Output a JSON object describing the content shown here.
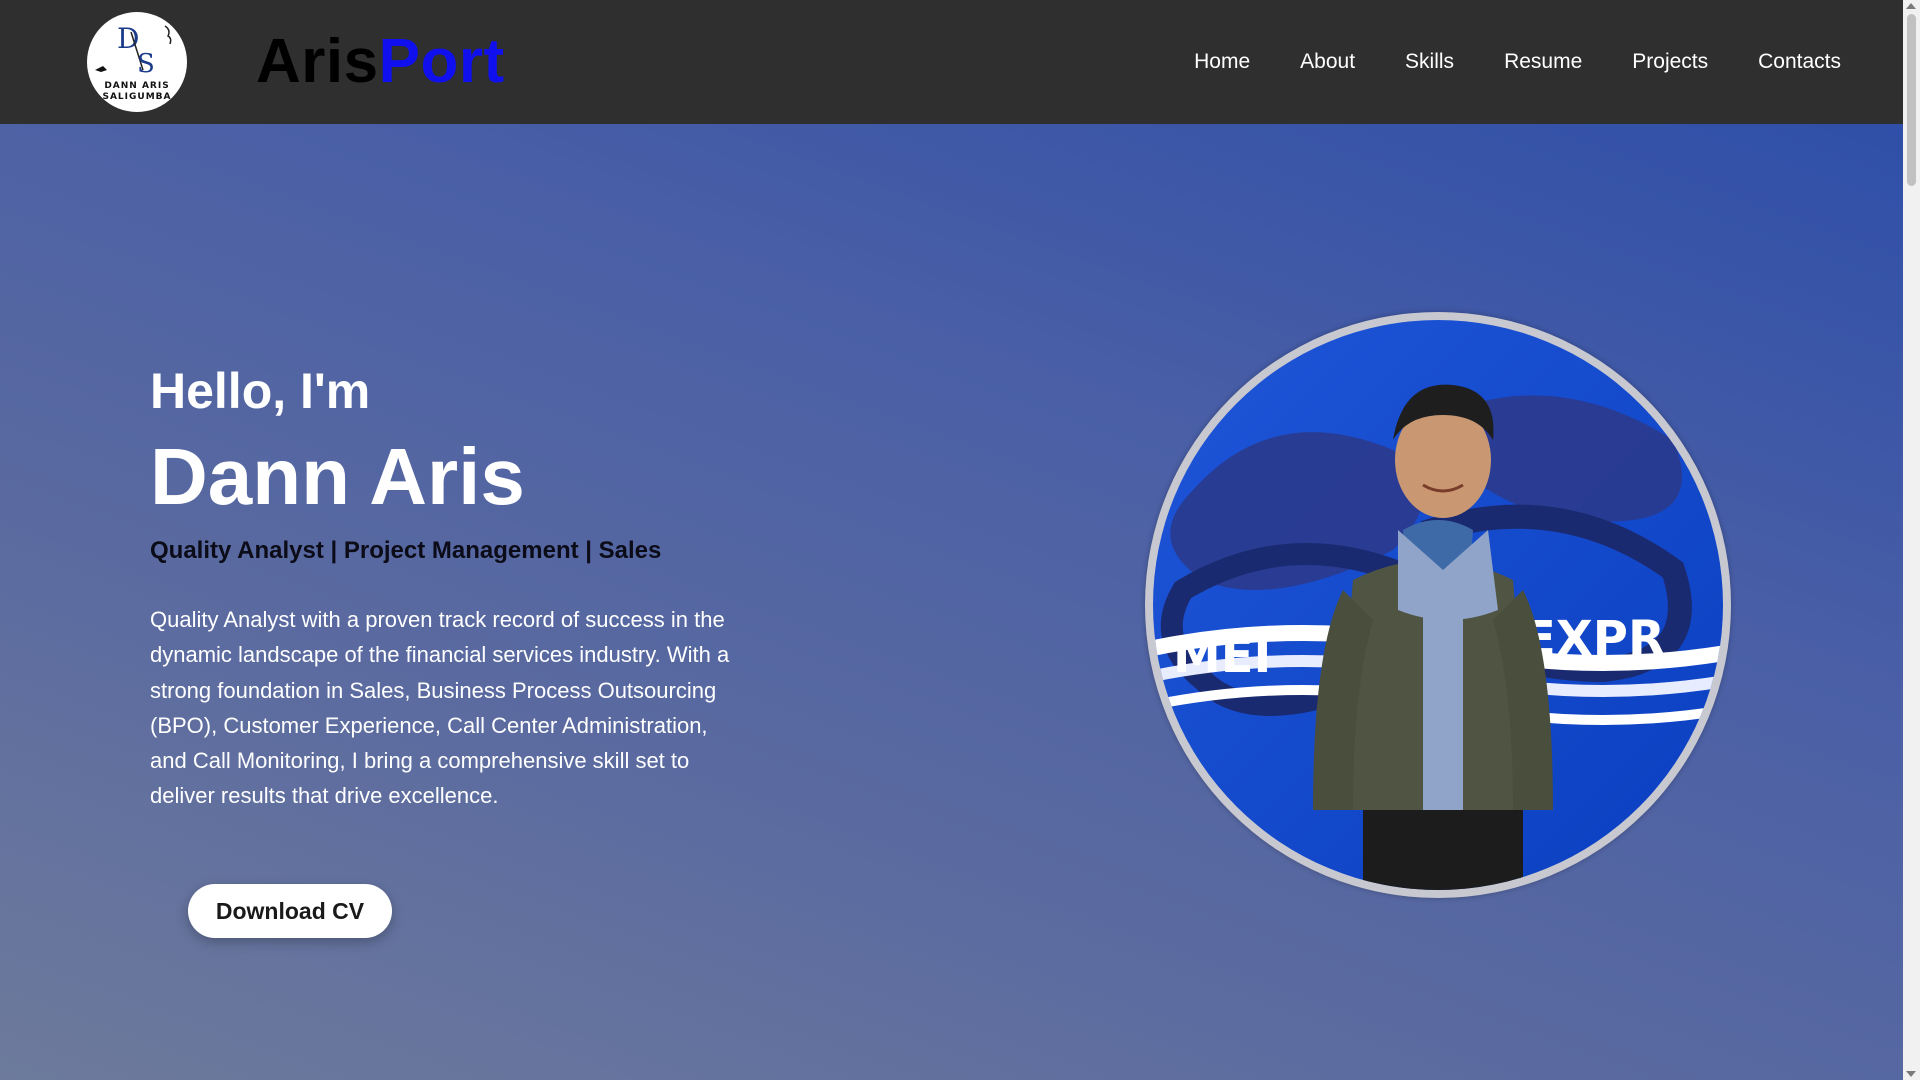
{
  "header": {
    "logo": {
      "initials": "DS",
      "caption_line1": "DANN ARIS",
      "caption_line2": "SALIGUMBA"
    },
    "brand_part1": "Aris",
    "brand_part2": "Port",
    "nav": [
      "Home",
      "About",
      "Skills",
      "Resume",
      "Projects",
      "Contacts"
    ]
  },
  "hero": {
    "greeting": "Hello, I'm",
    "name": "Dann Aris",
    "roles": "Quality Analyst | Project Management | Sales",
    "bio": "Quality Analyst with a proven track record of success in the dynamic landscape of the financial services industry. With a strong foundation in Sales, Business Process Outsourcing (BPO), Customer Experience, Call Center Administration, and Call Monitoring, I bring a comprehensive skill set to deliver results that drive excellence.",
    "cta": "Download CV",
    "photo": {
      "background_text_left": "MEI",
      "background_text_right": "EXPR"
    }
  },
  "colors": {
    "header_bg": "#2f2f2f",
    "brand_part1": "#000000",
    "brand_part2": "#1010ee",
    "hero_gradient_start": "#6d7a9c",
    "hero_gradient_end": "#2f4fa8",
    "roles_text": "#0c0c18",
    "button_bg": "#ffffff"
  },
  "icons": [
    "scroll-up-arrow-icon",
    "scroll-down-arrow-icon"
  ]
}
